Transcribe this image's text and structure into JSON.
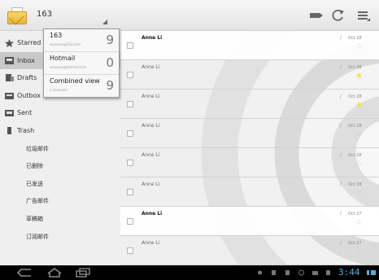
{
  "header": {
    "account_name": "163"
  },
  "account_menu": [
    {
      "name": "163",
      "sub": "xxxxxxx@163.com",
      "count": "9"
    },
    {
      "name": "Hotmail",
      "sub": "xxxxxxx@hotmail.com",
      "count": "0"
    },
    {
      "name": "Combined view",
      "sub": "2 accounts",
      "count": "9"
    }
  ],
  "folders": [
    {
      "label": "Starred",
      "icon": "star-icon"
    },
    {
      "label": "Inbox",
      "icon": "inbox-icon"
    },
    {
      "label": "Drafts",
      "icon": "draft-icon"
    },
    {
      "label": "Outbox",
      "icon": "outbox-icon"
    },
    {
      "label": "Sent",
      "icon": "sent-icon"
    },
    {
      "label": "Trash",
      "icon": "trash-icon"
    },
    {
      "label": "垃圾邮件"
    },
    {
      "label": "已删除"
    },
    {
      "label": "已发送"
    },
    {
      "label": "广告邮件"
    },
    {
      "label": "草稿箱"
    },
    {
      "label": "订阅邮件"
    }
  ],
  "messages": [
    {
      "sender": "Anne Li",
      "date": "Oct 28",
      "unread": true,
      "starred": false
    },
    {
      "sender": "Anne Li",
      "date": "Oct 28",
      "unread": false,
      "starred": true
    },
    {
      "sender": "Anne Li",
      "date": "Oct 28",
      "unread": false,
      "starred": true
    },
    {
      "sender": "Anne Li",
      "date": "Oct 28",
      "unread": false,
      "starred": false
    },
    {
      "sender": "Anne Li",
      "date": "Oct 28",
      "unread": false,
      "starred": false
    },
    {
      "sender": "Anne Li",
      "date": "Oct 28",
      "unread": false,
      "starred": false
    },
    {
      "sender": "Anne Li",
      "date": "Oct 27",
      "unread": true,
      "starred": false
    },
    {
      "sender": "Anne Li",
      "date": "Oct 27",
      "unread": false,
      "starred": false
    }
  ],
  "status_bar": {
    "clock": "3:44"
  },
  "colors": {
    "accent_clock": "#4fb0d8",
    "star_on": "#f1e23b",
    "selected_folder": "#c9c9c9"
  }
}
